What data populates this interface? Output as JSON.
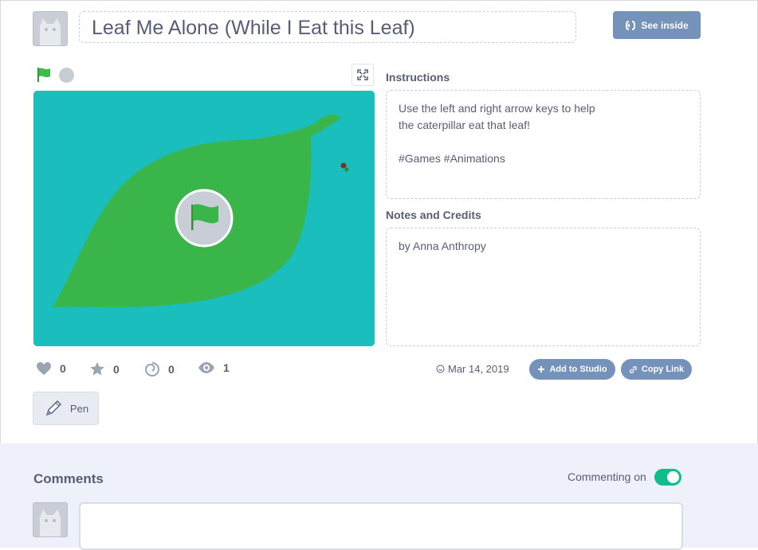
{
  "project": {
    "title": "Leaf Me Alone (While I Eat this Leaf)",
    "see_inside_label": "See inside"
  },
  "instructions": {
    "heading": "Instructions",
    "lines": [
      "Use the left and right arrow keys to help",
      "the caterpillar eat that leaf!",
      "",
      "#Games #Animations"
    ]
  },
  "notes": {
    "heading": "Notes and Credits",
    "text": "by Anna Anthropy"
  },
  "stats": {
    "loves": "0",
    "favorites": "0",
    "remixes": "0",
    "views": "1"
  },
  "meta": {
    "date": "Mar 14, 2019",
    "add_to_studio_label": "Add to Studio",
    "copy_link_label": "Copy Link"
  },
  "extensions": [
    {
      "label": "Pen",
      "icon": "pen-icon"
    }
  ],
  "comments": {
    "heading": "Comments",
    "commenting_label": "Commenting on",
    "commenting_enabled": true
  },
  "colors": {
    "stage_background": "#19bebd",
    "leaf": "#3ab54a",
    "button_blue": "#7592ba",
    "toggle_on": "#0fbd8c",
    "flag_green": "#3dbd48"
  },
  "icons": {
    "green_flag": "green-flag-icon",
    "stop": "stop-icon",
    "fullscreen": "fullscreen-icon",
    "see_inside": "see-inside-icon",
    "love": "heart-icon",
    "favorite": "star-icon",
    "remix": "remix-icon",
    "views": "eye-icon",
    "date": "clock-icon",
    "add": "plus-icon",
    "link": "link-icon"
  }
}
